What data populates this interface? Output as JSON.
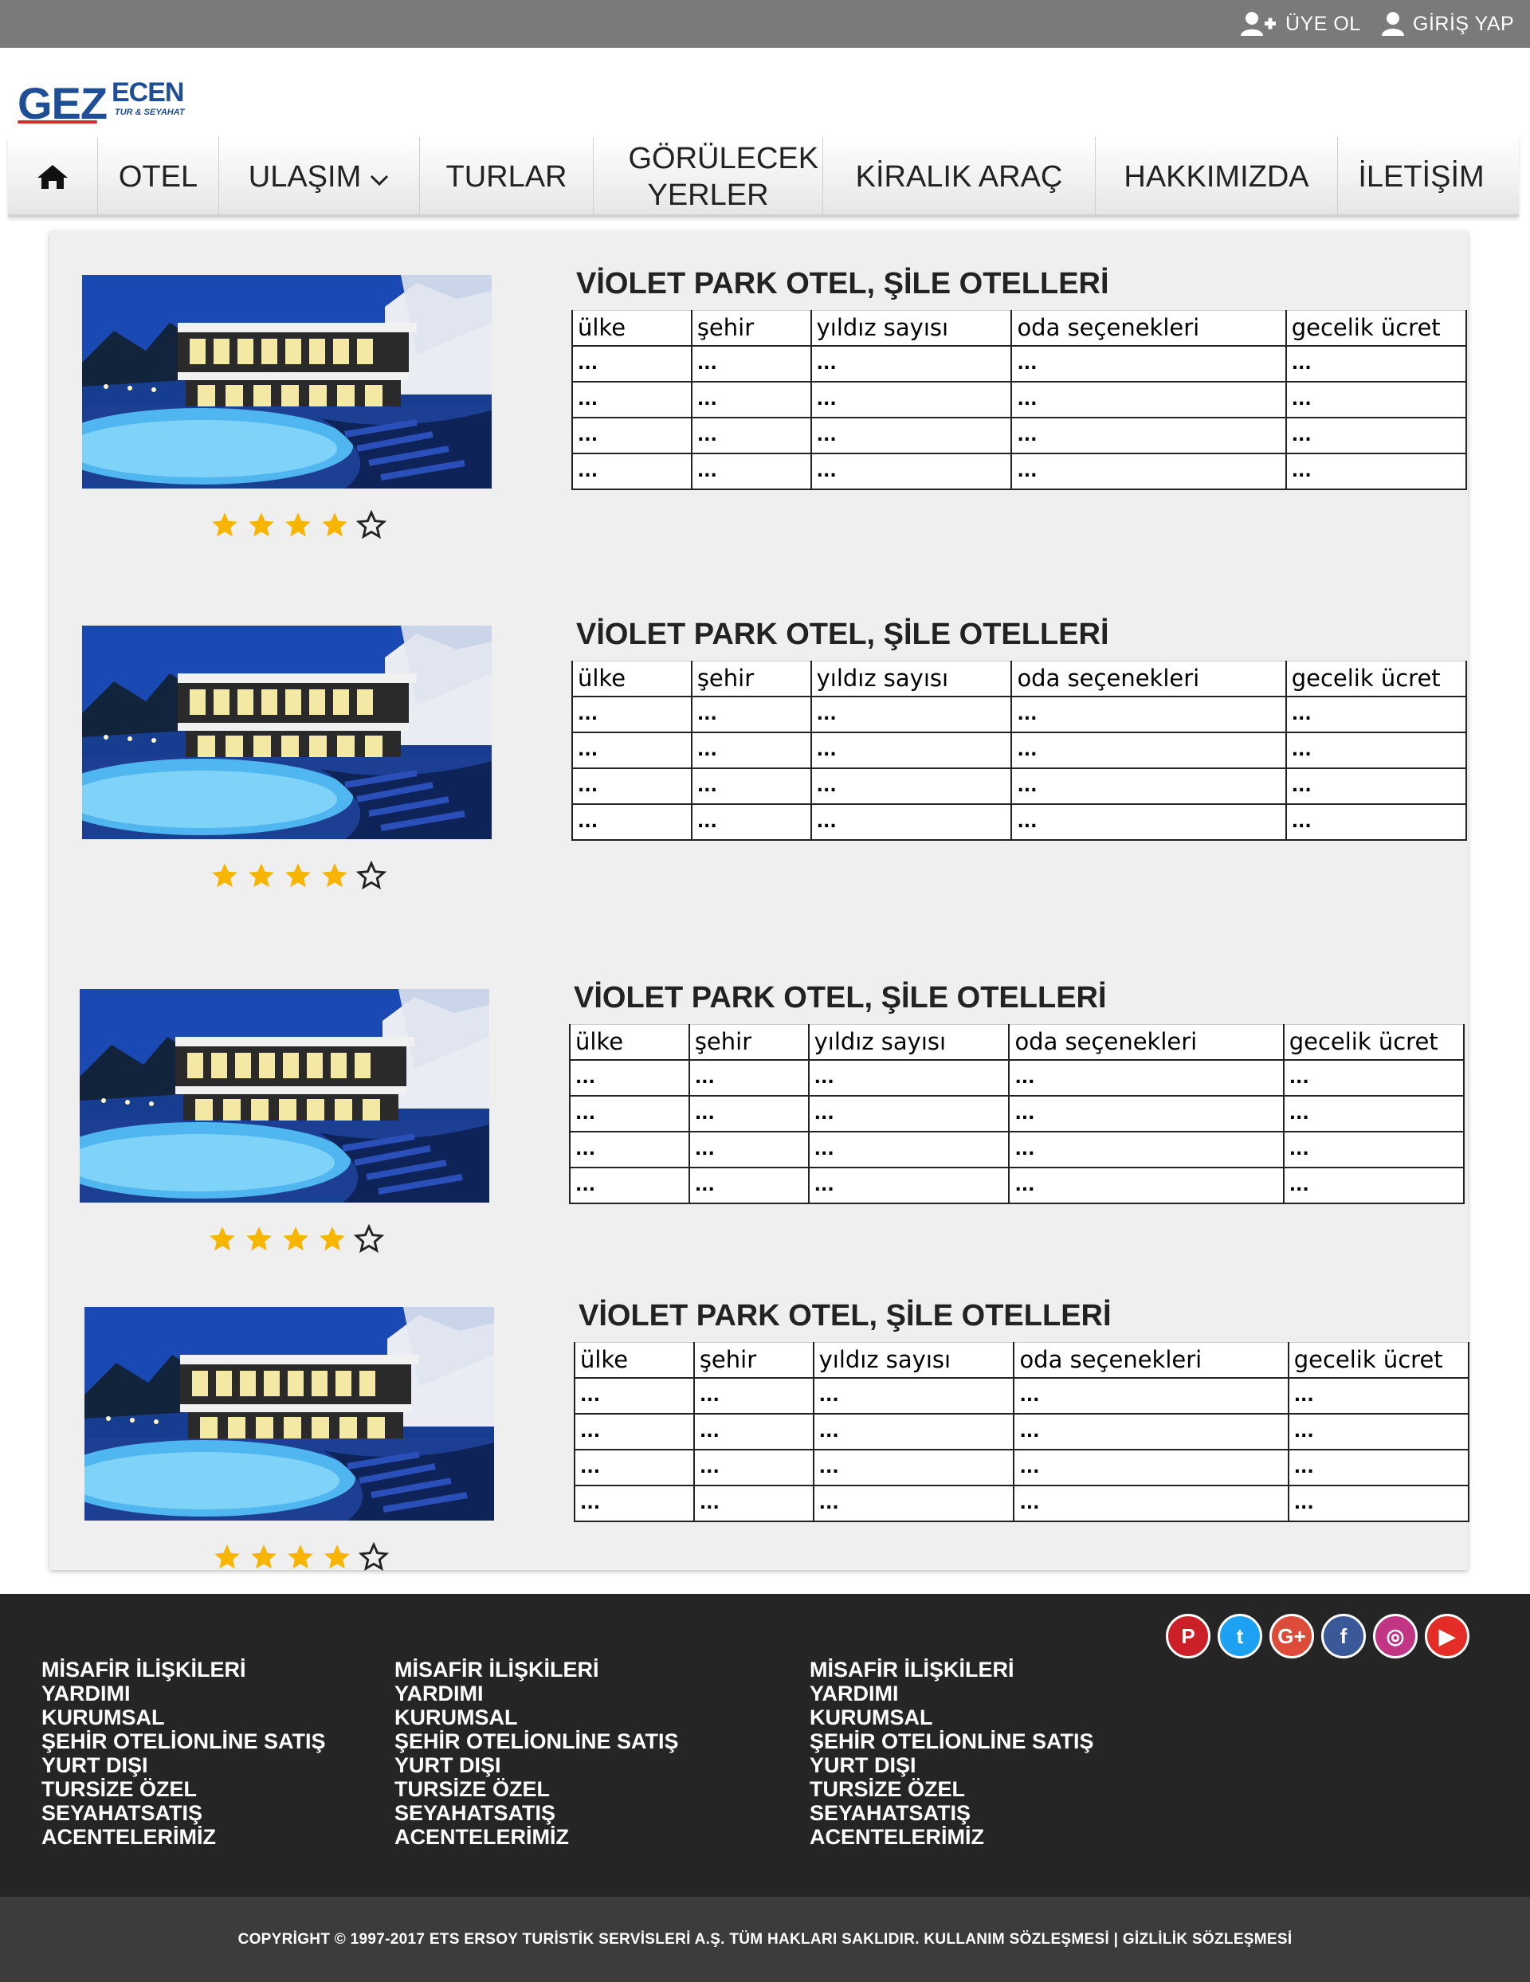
{
  "header": {
    "signup_label": "ÜYE OL",
    "login_label": "GİRİŞ YAP"
  },
  "logo": {
    "text_main": "GEZ",
    "text_secondary": "ECEN",
    "tagline": "TUR & SEYAHAT"
  },
  "nav": {
    "home_icon": "home-icon",
    "items": [
      "OTEL",
      "ULAŞIM",
      "TURLAR",
      "GÖRÜLECEK YERLER",
      "KİRALIK ARAÇ",
      "HAKKIMIZDA",
      "İLETİŞİM"
    ]
  },
  "hotels": [
    {
      "title": "VİOLET PARK OTEL, ŞİLE OTELLERİ",
      "rating": 4,
      "rating_max": 5,
      "columns": [
        "ülke",
        "şehir",
        "yıldız sayısı",
        "oda seçenekleri",
        "gecelik ücret"
      ],
      "rows": [
        [
          "...",
          "...",
          "...",
          "...",
          "..."
        ],
        [
          "...",
          "...",
          "...",
          "...",
          "..."
        ],
        [
          "...",
          "...",
          "...",
          "...",
          "..."
        ],
        [
          "...",
          "...",
          "...",
          "...",
          "..."
        ]
      ]
    },
    {
      "title": "VİOLET PARK OTEL, ŞİLE OTELLERİ",
      "rating": 4,
      "rating_max": 5,
      "columns": [
        "ülke",
        "şehir",
        "yıldız sayısı",
        "oda seçenekleri",
        "gecelik ücret"
      ],
      "rows": [
        [
          "...",
          "...",
          "...",
          "...",
          "..."
        ],
        [
          "...",
          "...",
          "...",
          "...",
          "..."
        ],
        [
          "...",
          "...",
          "...",
          "...",
          "..."
        ],
        [
          "...",
          "...",
          "...",
          "...",
          "..."
        ]
      ]
    },
    {
      "title": "VİOLET PARK OTEL, ŞİLE OTELLERİ",
      "rating": 4,
      "rating_max": 5,
      "columns": [
        "ülke",
        "şehir",
        "yıldız sayısı",
        "oda seçenekleri",
        "gecelik ücret"
      ],
      "rows": [
        [
          "...",
          "...",
          "...",
          "...",
          "..."
        ],
        [
          "...",
          "...",
          "...",
          "...",
          "..."
        ],
        [
          "...",
          "...",
          "...",
          "...",
          "..."
        ],
        [
          "...",
          "...",
          "...",
          "...",
          "..."
        ]
      ]
    },
    {
      "title": "VİOLET PARK OTEL, ŞİLE OTELLERİ",
      "rating": 4,
      "rating_max": 5,
      "columns": [
        "ülke",
        "şehir",
        "yıldız sayısı",
        "oda seçenekleri",
        "gecelik ücret"
      ],
      "rows": [
        [
          "...",
          "...",
          "...",
          "...",
          "..."
        ],
        [
          "...",
          "...",
          "...",
          "...",
          "..."
        ],
        [
          "...",
          "...",
          "...",
          "...",
          "..."
        ],
        [
          "...",
          "...",
          "...",
          "...",
          "..."
        ]
      ]
    }
  ],
  "footer": {
    "social": [
      {
        "icon": "pinterest-icon",
        "glyph": "P",
        "color": "#cb2027"
      },
      {
        "icon": "twitter-icon",
        "glyph": "t",
        "color": "#1da1f2"
      },
      {
        "icon": "google-plus-icon",
        "glyph": "G+",
        "color": "#dd4b39"
      },
      {
        "icon": "facebook-icon",
        "glyph": "f",
        "color": "#3b5998"
      },
      {
        "icon": "instagram-icon",
        "glyph": "◎",
        "color": "#c13584"
      },
      {
        "icon": "youtube-icon",
        "glyph": "▶",
        "color": "#e52d27"
      }
    ],
    "columns": [
      [
        "MİSAFİR İLİŞKİLERİ",
        "YARDIMI",
        "KURUMSAL",
        "ŞEHİR OTELİONLİNE SATIŞ",
        "YURT DIŞI",
        "TURSİZE ÖZEL",
        "SEYAHATSATIŞ",
        "ACENTELERİMİZ"
      ],
      [
        "MİSAFİR İLİŞKİLERİ",
        "YARDIMI",
        "KURUMSAL",
        "ŞEHİR OTELİONLİNE SATIŞ",
        "YURT DIŞI",
        "TURSİZE ÖZEL",
        "SEYAHATSATIŞ",
        "ACENTELERİMİZ"
      ],
      [
        "MİSAFİR İLİŞKİLERİ",
        "YARDIMI",
        "KURUMSAL",
        "ŞEHİR OTELİONLİNE SATIŞ",
        "YURT DIŞI",
        "TURSİZE ÖZEL",
        "SEYAHATSATIŞ",
        "ACENTELERİMİZ"
      ]
    ],
    "copyright": "COPYRİGHT © 1997-2017 ETS ERSOY TURİSTİK SERVİSLERİ A.Ş. TÜM HAKLARI SAKLIDIR. KULLANIM SÖZLEŞMESİ | GİZLİLİK SÖZLEŞMESİ"
  },
  "colors": {
    "topbar": "#7a7a7a",
    "brand": "#1d4e96",
    "star": "#f7b500",
    "footer": "#252525",
    "copybar": "#3c3c3c"
  }
}
